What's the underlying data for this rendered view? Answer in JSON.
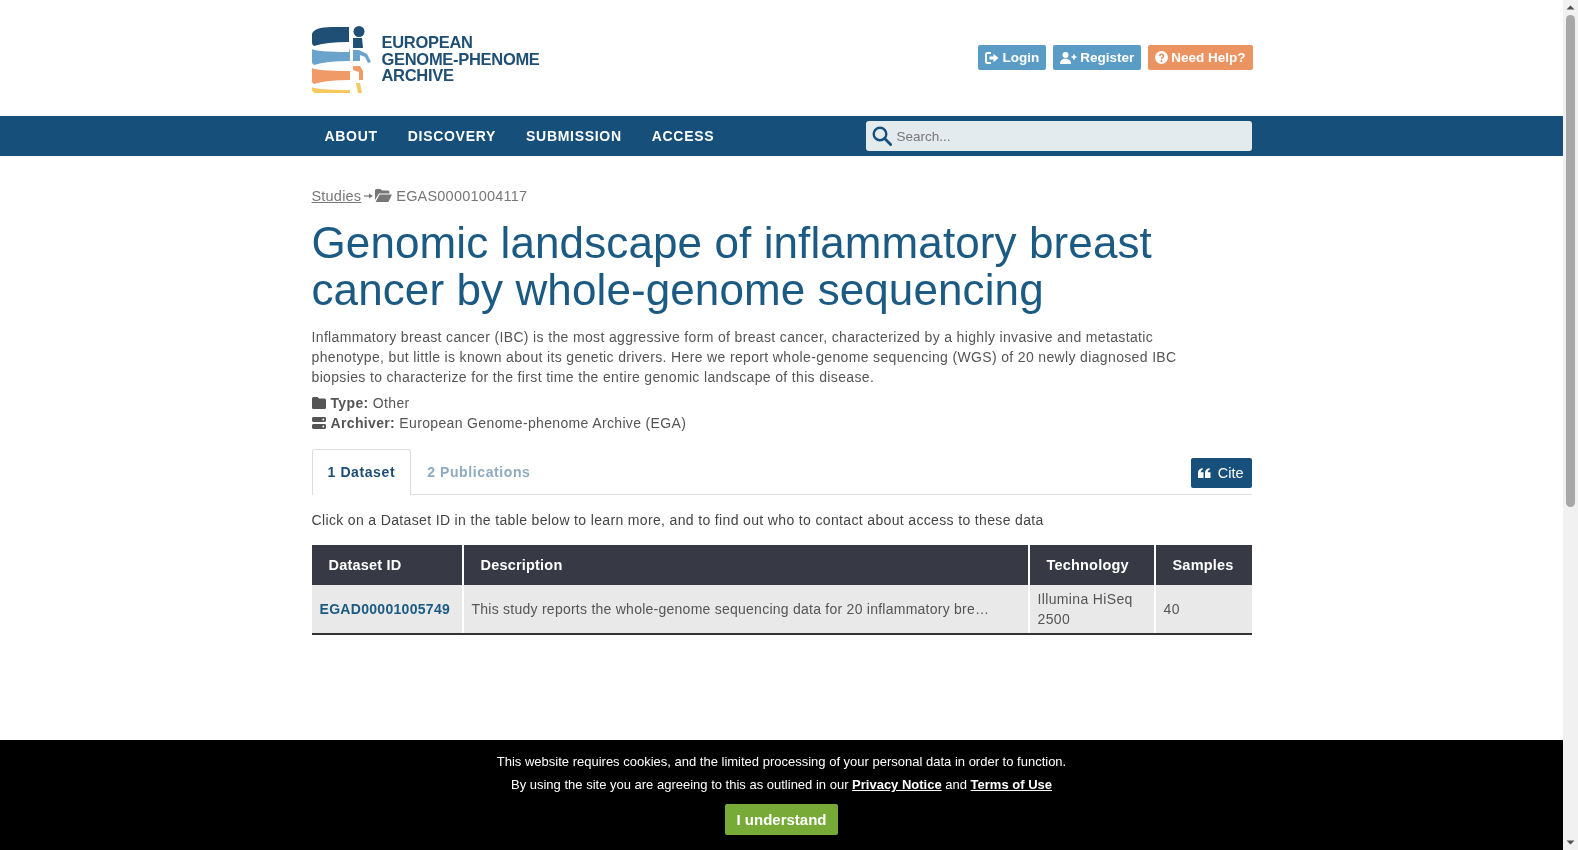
{
  "header": {
    "logo": {
      "lines": [
        "EUROPEAN",
        "GENOME-PHENOME",
        "ARCHIVE"
      ]
    },
    "buttons": [
      {
        "kind": "login",
        "label": "Login"
      },
      {
        "kind": "register",
        "label": "Register"
      },
      {
        "kind": "help",
        "label": "Need Help?"
      }
    ]
  },
  "nav": {
    "items": [
      "ABOUT",
      "DISCOVERY",
      "SUBMISSION",
      "ACCESS"
    ],
    "search": {
      "placeholder": "Search..."
    }
  },
  "breadcrumb": [
    {
      "kind": "link",
      "label": "Studies"
    },
    {
      "kind": "current",
      "label": "EGAS00001004117"
    }
  ],
  "study": {
    "title": "Genomic landscape of inflammatory breast cancer by whole-genome sequencing",
    "description": "Inflammatory breast cancer (IBC) is the most aggressive form of breast cancer, characterized by a highly invasive and metastatic phenotype, but little is known about its genetic drivers. Here we report whole-genome sequencing (WGS) of 20 newly diagnosed IBC biopsies to characterize for the first time the entire genomic landscape of this disease.",
    "meta": [
      {
        "kind": "type",
        "text": "**Type:** Other"
      },
      {
        "kind": "archiver",
        "text": "**Archiver:** European Genome-phenome Archive (EGA)"
      }
    ]
  },
  "tabs": [
    {
      "label": "1 Dataset",
      "selected": true
    },
    {
      "label": "2 Publications",
      "selected": false
    }
  ],
  "cite_button": {
    "label": "Cite"
  },
  "instruction": "Click on a Dataset ID in the table below to learn more, and to find out who to contact about access to these data",
  "table": {
    "columns": [
      "Dataset ID",
      "Description",
      "Technology",
      "Samples"
    ],
    "rows": [
      {
        "cells": [
          {
            "kind": "link",
            "text": "EGAD00001005749"
          },
          {
            "kind": "text",
            "text": "This study reports the whole-genome sequencing data for 20 inflammatory bre…"
          },
          {
            "kind": "text",
            "text": "Illumina HiSeq 2500"
          },
          {
            "kind": "text",
            "text": "40"
          }
        ]
      }
    ]
  },
  "cookie_banner": {
    "message": "This website requires cookies, and the limited processing of your personal data in order to function.",
    "notice": [
      {
        "kind": "text",
        "text": "By using the site you are agreeing to this as outlined in our "
      },
      {
        "kind": "link",
        "text": "Privacy Notice"
      },
      {
        "kind": "text",
        "text": " and "
      },
      {
        "kind": "link",
        "text": "Terms of Use"
      }
    ],
    "button": {
      "label": "I understand"
    }
  }
}
